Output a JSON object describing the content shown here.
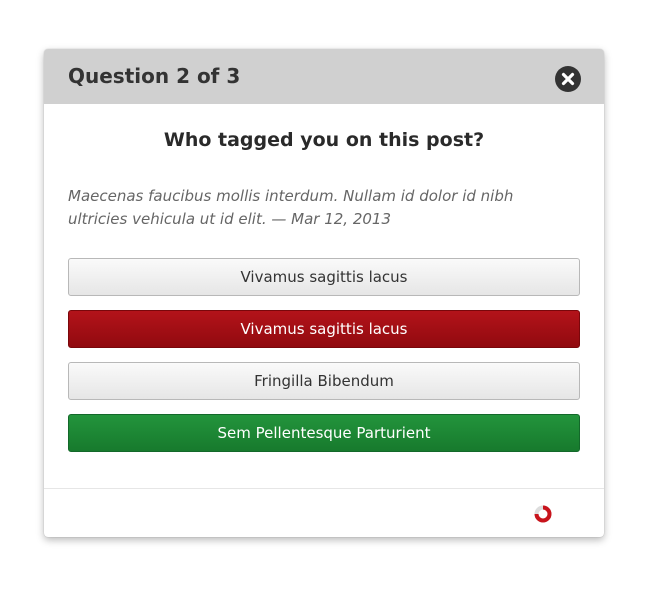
{
  "dialog": {
    "title": "Question 2 of 3",
    "close_icon": "close-icon",
    "question": "Who tagged you on this post?",
    "context": "Maecenas faucibus mollis interdum. Nullam id dolor id nibh ultricies vehicula ut id elit. — Mar 12, 2013",
    "answers": [
      {
        "label": "Vivamus sagittis lacus",
        "state": "neutral"
      },
      {
        "label": "Vivamus sagittis lacus",
        "state": "wrong"
      },
      {
        "label": "Fringilla Bibendum",
        "state": "neutral"
      },
      {
        "label": "Sem Pellentesque Parturient",
        "state": "correct"
      }
    ],
    "progress_icon": "progress-ring-icon"
  },
  "colors": {
    "header_bg": "#d0d0d0",
    "wrong": "#a00e14",
    "correct": "#1d8a35",
    "progress": "#c8141c"
  }
}
